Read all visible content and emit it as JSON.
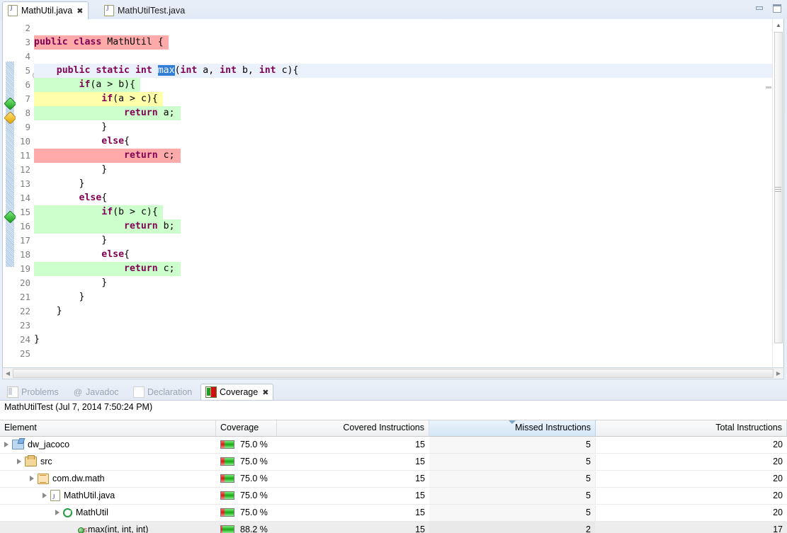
{
  "window": {
    "minimize_label": "Minimize",
    "maximize_label": "Maximize"
  },
  "editor": {
    "tabs": [
      {
        "label": "MathUtil.java",
        "icon": "java-file-icon",
        "active": true,
        "close_glyph": "✖"
      },
      {
        "label": "MathUtilTest.java",
        "icon": "java-file-icon",
        "active": false,
        "close_glyph": ""
      }
    ],
    "lines": [
      {
        "no": "2",
        "text": "",
        "highlight": "none"
      },
      {
        "no": "3",
        "text": "public class MathUtil {",
        "highlight": "red"
      },
      {
        "no": "4",
        "text": "",
        "highlight": "none"
      },
      {
        "no": "5",
        "text": "    public static int max(int a, int b, int c){",
        "highlight": "caret"
      },
      {
        "no": "6",
        "text": "        if(a > b){",
        "highlight": "green"
      },
      {
        "no": "7",
        "text": "            if(a > c){",
        "highlight": "yellow"
      },
      {
        "no": "8",
        "text": "                return a;",
        "highlight": "green"
      },
      {
        "no": "9",
        "text": "            }",
        "highlight": "none"
      },
      {
        "no": "10",
        "text": "            else{",
        "highlight": "none"
      },
      {
        "no": "11",
        "text": "                return c;",
        "highlight": "red"
      },
      {
        "no": "12",
        "text": "            }",
        "highlight": "none"
      },
      {
        "no": "13",
        "text": "        }",
        "highlight": "none"
      },
      {
        "no": "14",
        "text": "        else{",
        "highlight": "none"
      },
      {
        "no": "15",
        "text": "            if(b > c){",
        "highlight": "green"
      },
      {
        "no": "16",
        "text": "                return b;",
        "highlight": "green"
      },
      {
        "no": "17",
        "text": "            }",
        "highlight": "none"
      },
      {
        "no": "18",
        "text": "            else{",
        "highlight": "none"
      },
      {
        "no": "19",
        "text": "                return c;",
        "highlight": "green"
      },
      {
        "no": "20",
        "text": "            }",
        "highlight": "none"
      },
      {
        "no": "21",
        "text": "        }",
        "highlight": "none"
      },
      {
        "no": "22",
        "text": "    }",
        "highlight": "none"
      },
      {
        "no": "23",
        "text": "",
        "highlight": "none"
      },
      {
        "no": "24",
        "text": "}",
        "highlight": "none"
      },
      {
        "no": "25",
        "text": "",
        "highlight": "none"
      }
    ],
    "selected_token": "max",
    "markers": [
      {
        "line": "6",
        "kind": "full-coverage-marker"
      },
      {
        "line": "7",
        "kind": "partial-coverage-marker"
      },
      {
        "line": "15",
        "kind": "full-coverage-marker"
      }
    ],
    "colors": {
      "covered": "#ccffcc",
      "missed": "#ffaaaa",
      "partial": "#ffffaa",
      "caret_line": "#eaf1fb",
      "selection": "#2f7fd8",
      "keyword": "#7f0055"
    }
  },
  "view": {
    "tabs": [
      {
        "label": "Problems",
        "icon": "problems-icon",
        "active": false
      },
      {
        "label": "Javadoc",
        "icon": "javadoc-icon",
        "active": false
      },
      {
        "label": "Declaration",
        "icon": "declaration-icon",
        "active": false
      },
      {
        "label": "Coverage",
        "icon": "coverage-icon",
        "active": true,
        "close_glyph": "✖"
      }
    ],
    "session_label": "MathUtilTest (Jul 7, 2014 7:50:24 PM)",
    "table": {
      "columns": [
        {
          "key": "element",
          "label": "Element",
          "align": "left",
          "sorted": false
        },
        {
          "key": "coverage",
          "label": "Coverage",
          "align": "left",
          "sorted": false
        },
        {
          "key": "covered",
          "label": "Covered Instructions",
          "align": "right",
          "sorted": false
        },
        {
          "key": "missed",
          "label": "Missed Instructions",
          "align": "right",
          "sorted": true
        },
        {
          "key": "total",
          "label": "Total Instructions",
          "align": "right",
          "sorted": false
        }
      ],
      "rows": [
        {
          "element": "dw_jacoco",
          "depth": 0,
          "icon": "project-icon",
          "expandable": true,
          "coverage": "75.0 %",
          "pct": 75.0,
          "covered": "15",
          "missed": "5",
          "total": "20",
          "selected": false
        },
        {
          "element": "src",
          "depth": 1,
          "icon": "source-folder-icon",
          "expandable": true,
          "coverage": "75.0 %",
          "pct": 75.0,
          "covered": "15",
          "missed": "5",
          "total": "20",
          "selected": false
        },
        {
          "element": "com.dw.math",
          "depth": 2,
          "icon": "package-icon",
          "expandable": true,
          "coverage": "75.0 %",
          "pct": 75.0,
          "covered": "15",
          "missed": "5",
          "total": "20",
          "selected": false
        },
        {
          "element": "MathUtil.java",
          "depth": 3,
          "icon": "java-file-icon",
          "expandable": true,
          "coverage": "75.0 %",
          "pct": 75.0,
          "covered": "15",
          "missed": "5",
          "total": "20",
          "selected": false
        },
        {
          "element": "MathUtil",
          "depth": 4,
          "icon": "class-icon",
          "expandable": true,
          "coverage": "75.0 %",
          "pct": 75.0,
          "covered": "15",
          "missed": "5",
          "total": "20",
          "selected": false
        },
        {
          "element": "max(int, int, int)",
          "depth": 5,
          "icon": "method-static-icon",
          "expandable": false,
          "coverage": "88.2 %",
          "pct": 88.2,
          "covered": "15",
          "missed": "2",
          "total": "17",
          "selected": true
        }
      ]
    }
  }
}
